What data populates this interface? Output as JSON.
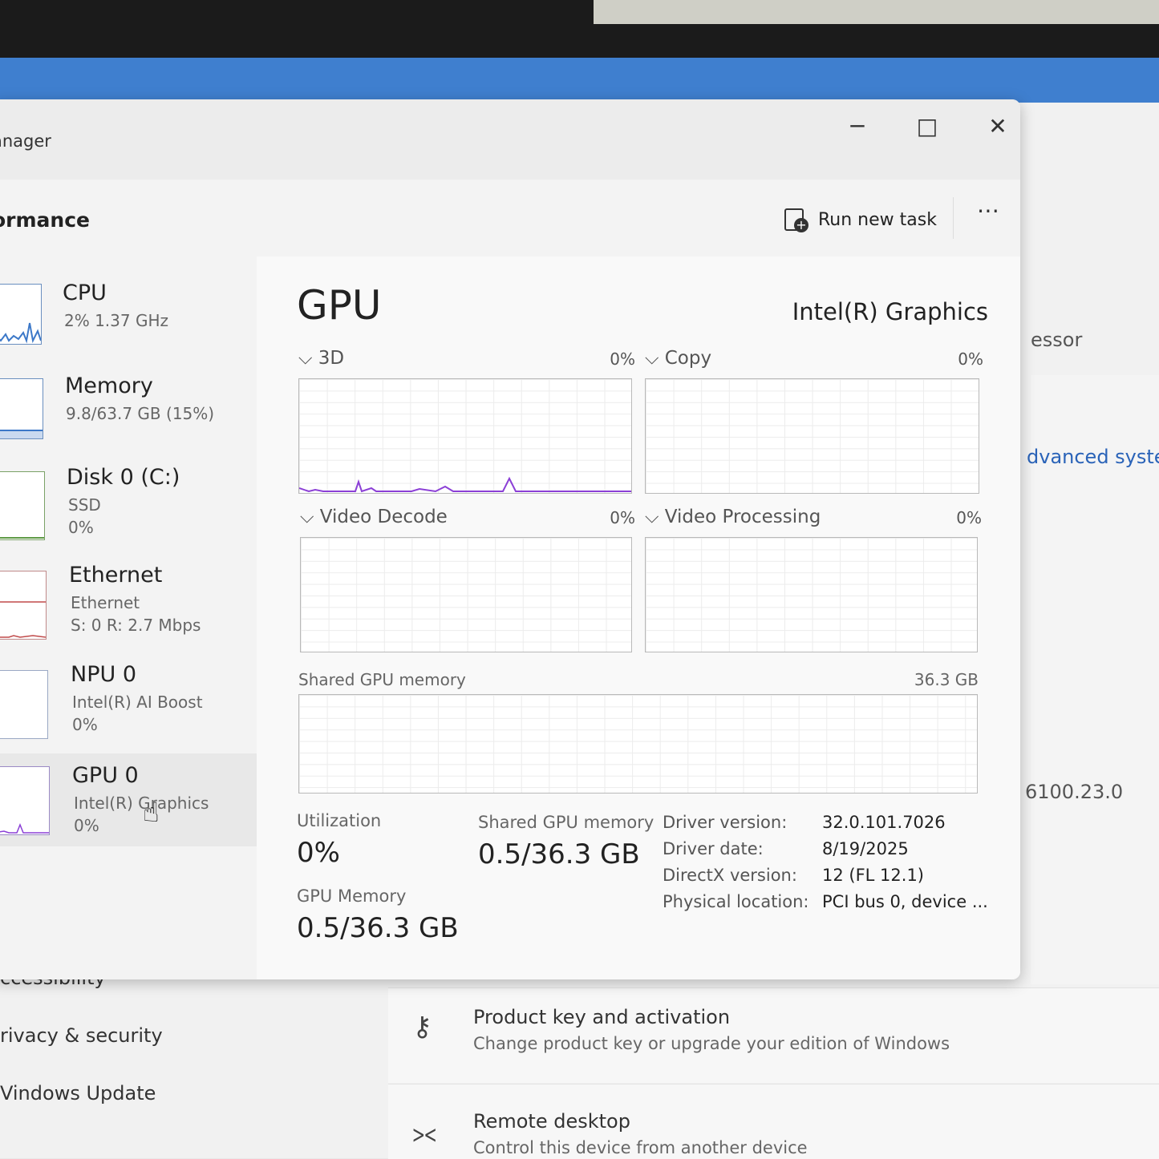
{
  "background": {
    "right_texts": {
      "processor": "essor",
      "advanced": "dvanced syste",
      "version": "6100.23.0"
    },
    "nav": {
      "accessibility": "ccessibility",
      "privacy": "rivacy & security",
      "update": "Vindows Update"
    },
    "cards": [
      {
        "icon": "key-icon",
        "title": "Product key and activation",
        "subtitle": "Change product key or upgrade your edition of Windows"
      },
      {
        "icon": "remote-desktop-icon",
        "title": "Remote desktop",
        "subtitle": "Control this device from another device"
      }
    ]
  },
  "window": {
    "title": "anager",
    "page_title": "ormance",
    "run_new_task": "Run new task",
    "more": "⋯"
  },
  "sidebar": [
    {
      "name": "CPU",
      "sub1": "2%  1.37 GHz",
      "sub2": ""
    },
    {
      "name": "Memory",
      "sub1": "9.8/63.7 GB (15%)",
      "sub2": ""
    },
    {
      "name": "Disk 0 (C:)",
      "sub1": "SSD",
      "sub2": "0%"
    },
    {
      "name": "Ethernet",
      "sub1": "Ethernet",
      "sub2": "S: 0  R: 2.7 Mbps"
    },
    {
      "name": "NPU 0",
      "sub1": "Intel(R) AI Boost",
      "sub2": "0%"
    },
    {
      "name": "GPU 0",
      "sub1": "Intel(R) Graphics",
      "sub2": "0%"
    }
  ],
  "gpu": {
    "title": "GPU",
    "model": "Intel(R) Graphics",
    "engines": [
      {
        "label": "3D",
        "percent": "0%"
      },
      {
        "label": "Copy",
        "percent": "0%"
      },
      {
        "label": "Video Decode",
        "percent": "0%"
      },
      {
        "label": "Video Processing",
        "percent": "0%"
      }
    ],
    "shared_memory_graph": {
      "label": "Shared GPU memory",
      "max": "36.3 GB"
    },
    "stats": {
      "utilization_label": "Utilization",
      "utilization_value": "0%",
      "shared_memory_label": "Shared GPU memory",
      "shared_memory_value": "0.5/36.3 GB",
      "gpu_memory_label": "GPU Memory",
      "gpu_memory_value": "0.5/36.3 GB"
    },
    "info": [
      {
        "key": "Driver version:",
        "value": "32.0.101.7026"
      },
      {
        "key": "Driver date:",
        "value": "8/19/2025"
      },
      {
        "key": "DirectX version:",
        "value": "12 (FL 12.1)"
      },
      {
        "key": "Physical location:",
        "value": "PCI bus 0, device ..."
      }
    ]
  },
  "colors": {
    "accent_3d": "#8b3fd6",
    "cpu_line": "#3c78c8",
    "ethernet_line": "#c04a4a",
    "desktop_blue": "#3f7fcf"
  }
}
